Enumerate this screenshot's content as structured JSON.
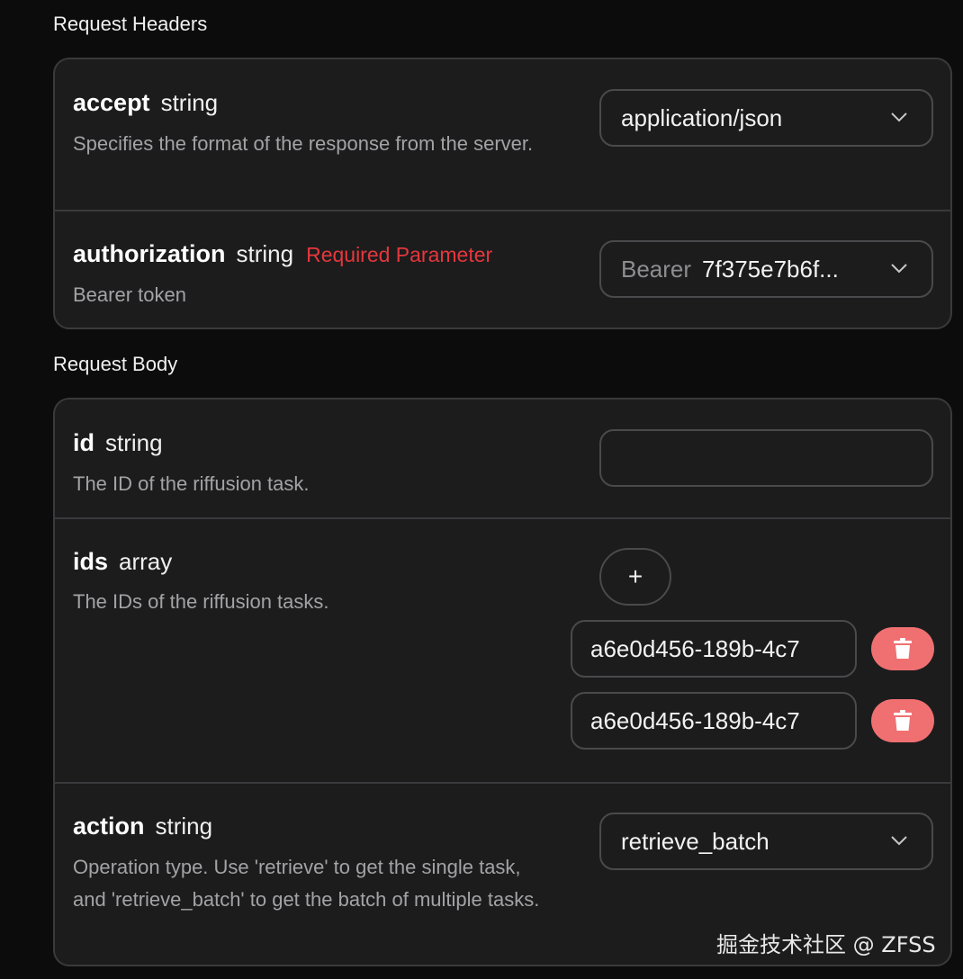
{
  "headers_section": {
    "title": "Request Headers",
    "params": [
      {
        "name": "accept",
        "type": "string",
        "description": "Specifies the format of the response from the server.",
        "control": {
          "kind": "select",
          "value": "application/json"
        }
      },
      {
        "name": "authorization",
        "type": "string",
        "required_label": "Required Parameter",
        "description": "Bearer token",
        "control": {
          "kind": "select",
          "prefix": "Bearer",
          "value": "7f375e7b6f..."
        }
      }
    ]
  },
  "body_section": {
    "title": "Request Body",
    "params": [
      {
        "name": "id",
        "type": "string",
        "description": "The ID of the riffusion task.",
        "control": {
          "kind": "input",
          "value": ""
        }
      },
      {
        "name": "ids",
        "type": "array",
        "description": "The IDs of the riffusion tasks.",
        "add_label": "+",
        "items": [
          "a6e0d456-189b-4c7",
          "a6e0d456-189b-4c7"
        ]
      },
      {
        "name": "action",
        "type": "string",
        "description": "Operation type. Use 'retrieve' to get the single task, and 'retrieve_batch' to get the batch of multiple tasks.",
        "control": {
          "kind": "select",
          "value": "retrieve_batch"
        }
      }
    ]
  },
  "watermark": "掘金技术社区 @ ZFSS",
  "colors": {
    "background": "#0c0c0c",
    "card": "#1c1c1d",
    "border": "#3a3a3c",
    "required": "#e5373d",
    "delete_button": "#f07072"
  },
  "icons": [
    "chevron-down-icon",
    "plus-icon",
    "trash-icon"
  ]
}
